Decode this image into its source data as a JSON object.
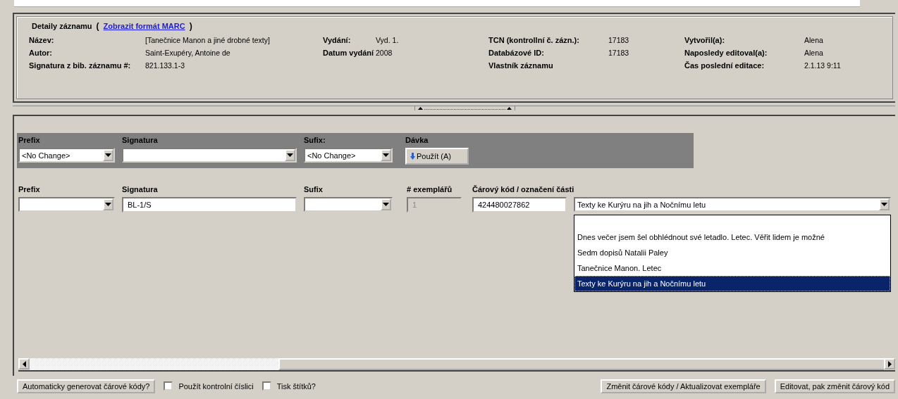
{
  "record_details": {
    "title": "Detaily záznamu",
    "bracket_open": "(",
    "link": "Zobrazit formát MARC",
    "bracket_close": ")",
    "groups": [
      [
        {
          "label": "Název:",
          "value": "[Tanečnice Manon a jiné drobné texty]"
        },
        {
          "label": "Autor:",
          "value": "Saint-Exupéry, Antoine de"
        },
        {
          "label": "Signatura z bib. záznamu #:",
          "value": "821.133.1-3"
        }
      ],
      [
        {
          "label": "Vydání:",
          "value": "Vyd. 1."
        },
        {
          "label": "Datum vydání",
          "value": "2008"
        }
      ],
      [
        {
          "label": "TCN (kontrollní č. zázn.):",
          "value": "17183"
        },
        {
          "label": "Databázové ID:",
          "value": "17183"
        },
        {
          "label": "Vlastník záznamu"
        }
      ],
      [
        {
          "label": "Vytvořil(a):",
          "value": "Alena"
        },
        {
          "label": "Naposledy editoval(a):",
          "value": "Alena"
        },
        {
          "label": "Čas poslední editace:",
          "value": "2.1.13 9:11"
        }
      ]
    ]
  },
  "batch": [
    {
      "label": "Prefix",
      "kind": "combo",
      "value": "<No Change>"
    },
    {
      "label": "Signatura",
      "kind": "combo"
    },
    {
      "label": "Sufix:",
      "kind": "combo",
      "value": "<No Change>"
    },
    {
      "label": "Dávka",
      "kind": "button",
      "button": "Použít (A)"
    }
  ],
  "item": [
    {
      "label": "Prefix",
      "kind": "combo"
    },
    {
      "label": "Signatura",
      "kind": "text",
      "value": "BL-1/S"
    },
    {
      "label": "Sufix",
      "kind": "combo"
    },
    {
      "label": "# exemplářů",
      "kind": "disabled",
      "value": "1"
    },
    {
      "label": "Čárový kód / označení části",
      "kind": "text",
      "value": "424480027862"
    },
    {
      "kind": "open_combo",
      "value": "Texty ke Kurýru na jih a Nočnímu letu",
      "options": [
        {
          "label": "Dnes večer jsem šel obhlédnout své letadlo. Letec. Věřit lidem je možné",
          "selected": false
        },
        {
          "label": "Sedm dopisů Natalii Paley",
          "selected": false
        },
        {
          "label": "Tanečnice Manon. Letec",
          "selected": false
        },
        {
          "label": "Texty ke Kurýru na jih a Nočnímu letu",
          "selected": true
        }
      ]
    }
  ],
  "footer": [
    {
      "kind": "button",
      "label": "Automaticky generovat čárové kódy?"
    },
    {
      "kind": "checkbox",
      "label": "Použít kontrolní číslici",
      "checked": false
    },
    {
      "kind": "checkbox",
      "label": "Tisk štítků?",
      "checked": false
    },
    {
      "kind": "spacer"
    },
    {
      "kind": "button",
      "label": "Změnit čárové kódy / Aktualizovat exempláře"
    },
    {
      "kind": "button",
      "label": "Editovat, pak změnit čárový kód"
    }
  ]
}
